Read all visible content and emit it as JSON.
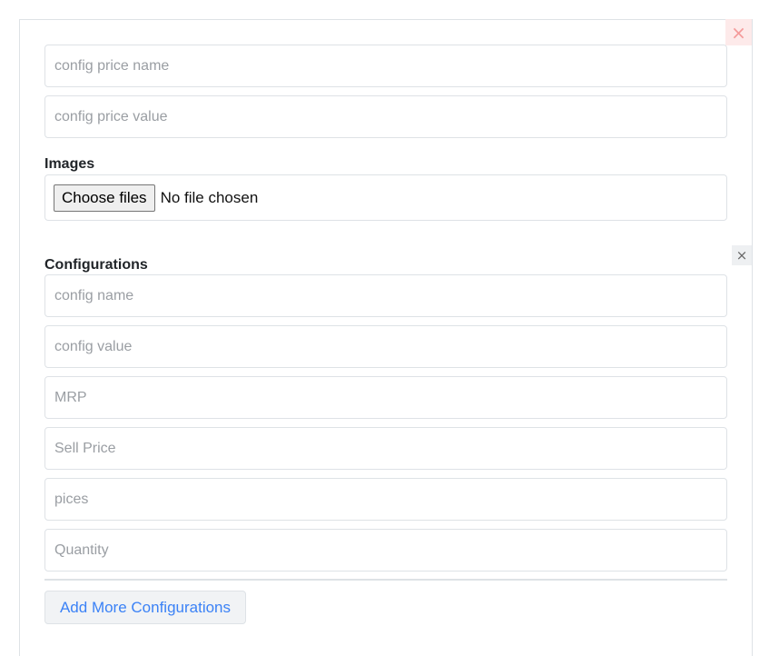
{
  "price": {
    "name_placeholder": "config price name",
    "value_placeholder": "config price value"
  },
  "images": {
    "label": "Images",
    "button": "Choose files",
    "status": "No file chosen"
  },
  "configurations": {
    "label": "Configurations",
    "fields": [
      "config name",
      "config value",
      "MRP",
      "Sell Price",
      "pices",
      "Quantity"
    ],
    "add_button": "Add More Configurations"
  },
  "icons": {
    "close": "×"
  }
}
